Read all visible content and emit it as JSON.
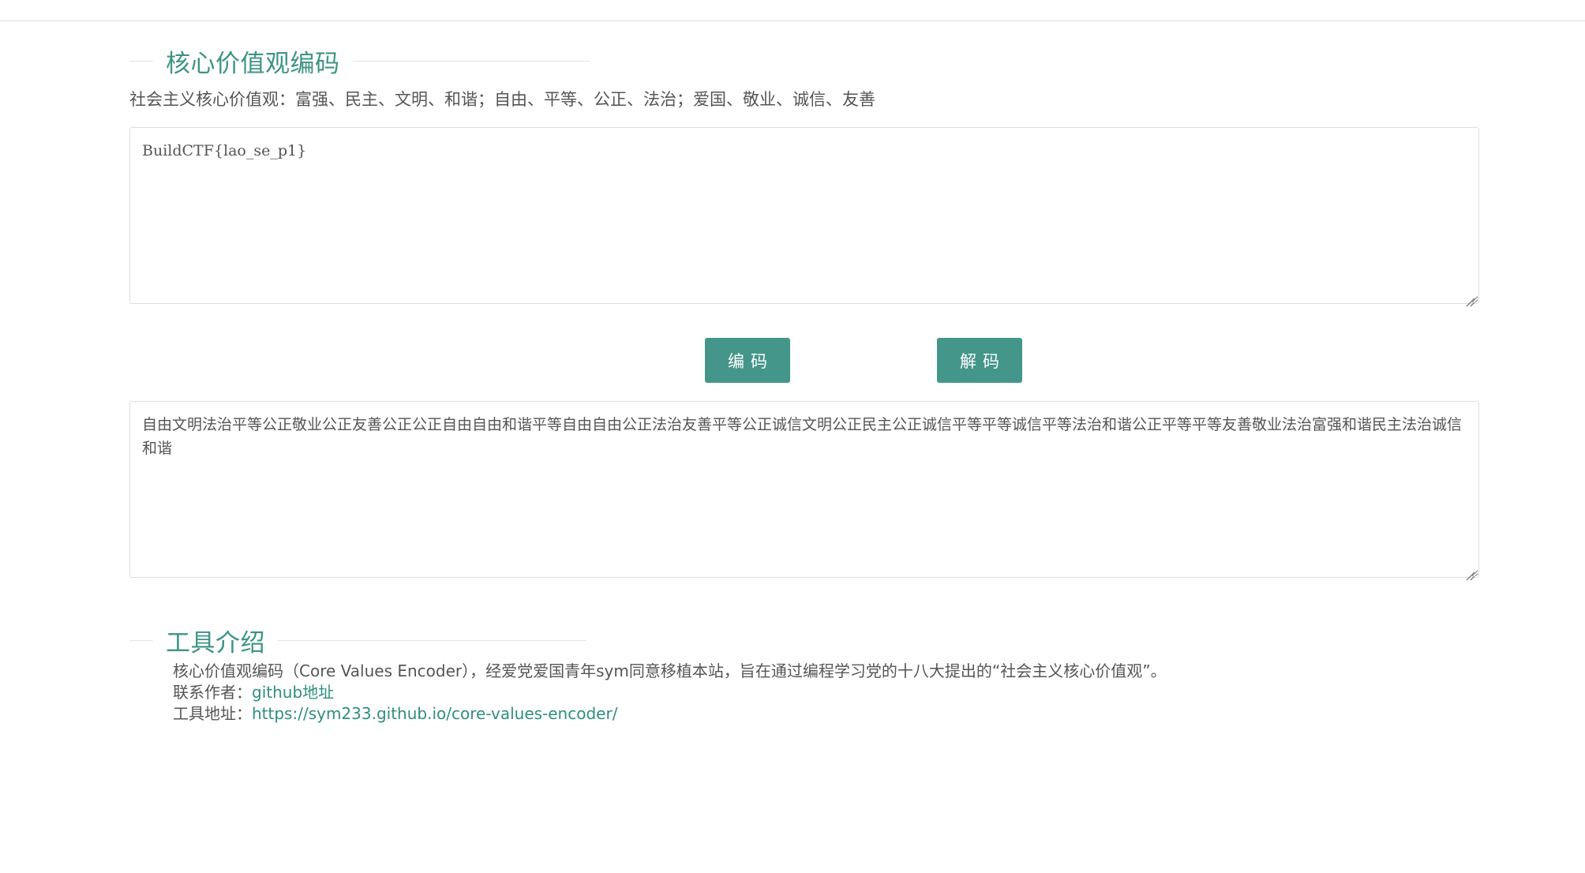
{
  "encoder_section": {
    "title": "核心价值观编码",
    "subtitle": "社会主义核心价值观：富强、民主、文明、和谐；自由、平等、公正、法治；爱国、敬业、诚信、友善"
  },
  "input_box": {
    "value": "BuildCTF{lao_se_p1}"
  },
  "buttons": {
    "encode_label": "编码",
    "decode_label": "解码"
  },
  "output_box": {
    "value": "自由文明法治平等公正敬业公正友善公正公正自由自由和谐平等自由自由公正法治友善平等公正诚信文明公正民主公正诚信平等平等诚信平等法治和谐公正平等平等友善敬业法治富强和谐民主法治诚信和谐"
  },
  "intro_section": {
    "title": "工具介绍",
    "description": "核心价值观编码（Core Values Encoder），经爱党爱国青年sym同意移植本站，旨在通过编程学习党的十八大提出的“社会主义核心价值观”。",
    "author_label": "联系作者：",
    "author_link": "github地址",
    "address_label": "工具地址：",
    "address_link": "https://sym233.github.io/core-values-encoder/"
  },
  "colors": {
    "accent": "#45968a",
    "title": "#3d9484",
    "link": "#2f8f7e",
    "text": "#555555",
    "border": "#dedede"
  }
}
